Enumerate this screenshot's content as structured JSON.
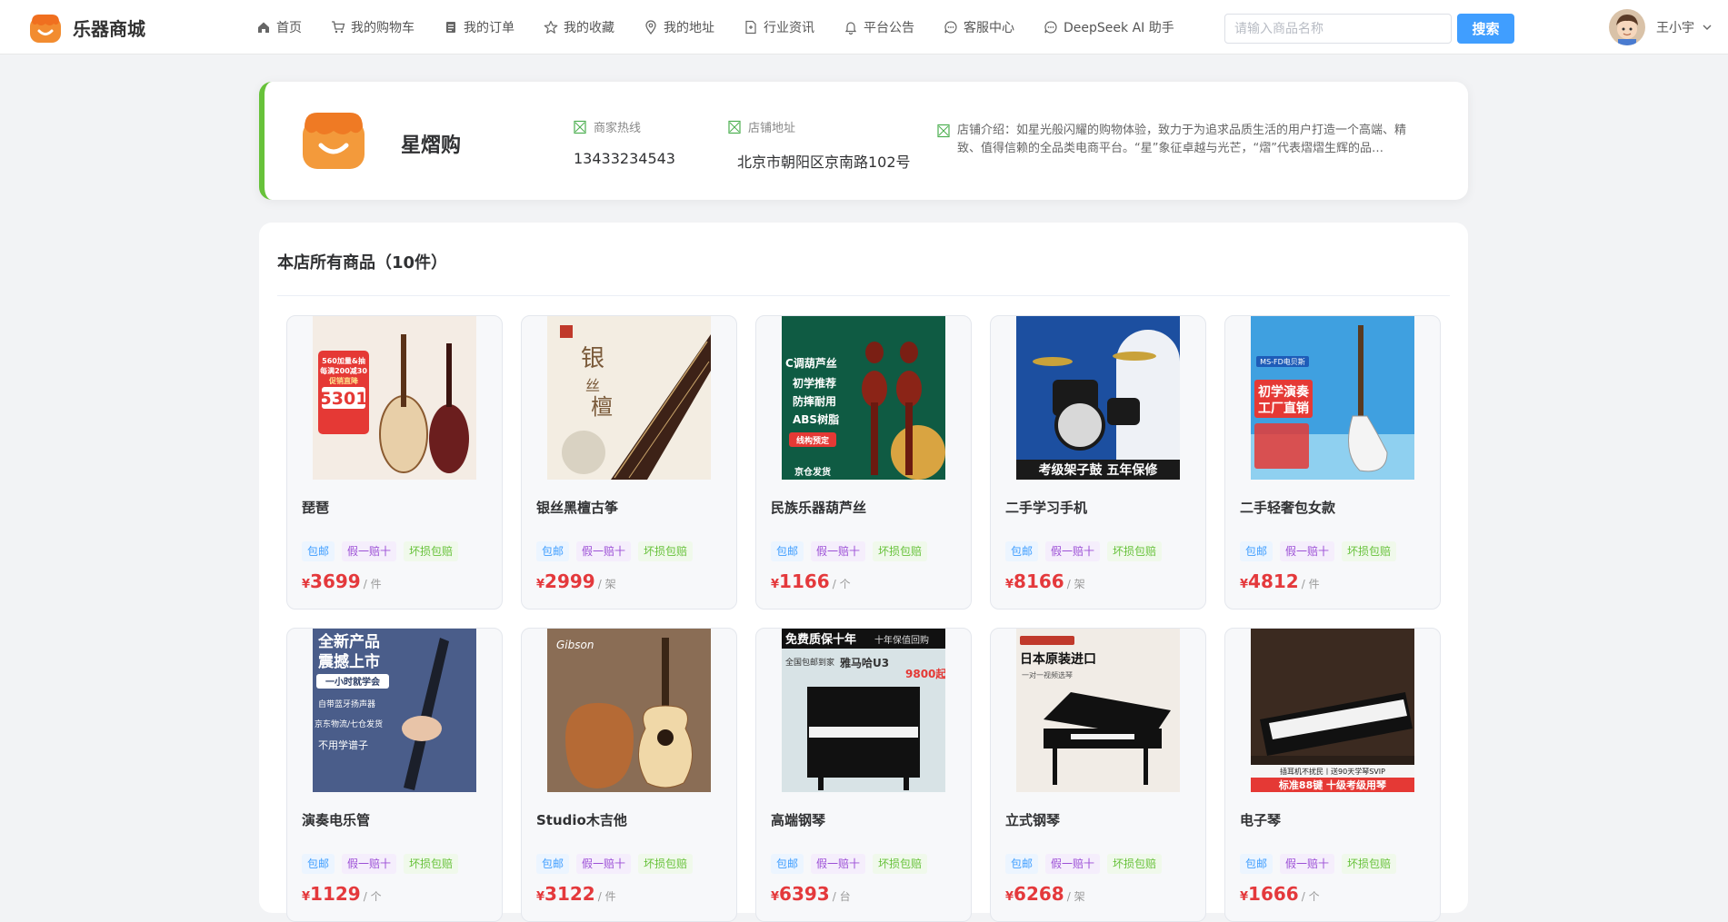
{
  "brand": {
    "name": "乐器商城"
  },
  "nav": [
    {
      "label": "首页",
      "icon": "home-icon"
    },
    {
      "label": "我的购物车",
      "icon": "cart-icon"
    },
    {
      "label": "我的订单",
      "icon": "order-icon"
    },
    {
      "label": "我的收藏",
      "icon": "star-icon"
    },
    {
      "label": "我的地址",
      "icon": "location-icon"
    },
    {
      "label": "行业资讯",
      "icon": "document-icon"
    },
    {
      "label": "平台公告",
      "icon": "bell-icon"
    },
    {
      "label": "客服中心",
      "icon": "chat-icon"
    },
    {
      "label": "DeepSeek AI 助手",
      "icon": "chat-icon"
    }
  ],
  "search": {
    "placeholder": "请输入商品名称",
    "button_label": "搜索"
  },
  "user": {
    "name": "王小宇"
  },
  "store": {
    "name": "星熠购",
    "hotline_label": "商家热线",
    "hotline": "13433234543",
    "address_label": "店铺地址",
    "address": "北京市朝阳区京南路102号",
    "intro": "店铺介绍：如星光般闪耀的购物体验，致力于为追求品质生活的用户打造一个高端、精致、值得信赖的全品类电商平台。“星”象征卓越与光芒，“熠”代表熠熠生辉的品…"
  },
  "products_panel": {
    "title": "本店所有商品（10件）"
  },
  "tags": [
    "包邮",
    "假一赔十",
    "坏损包赔"
  ],
  "currency": "¥",
  "products": [
    {
      "name": "琵琶",
      "price": "3699",
      "unit": "/ 件",
      "image_text": [
        "560加量&抽",
        "每满200减30",
        "促销直降",
        "5301"
      ]
    },
    {
      "name": "银丝黑檀古筝",
      "price": "2999",
      "unit": "/ 架",
      "image_text": [
        "银",
        "丝",
        "檀"
      ]
    },
    {
      "name": "民族乐器葫芦丝",
      "price": "1166",
      "unit": "/ 个",
      "image_text": [
        "C调葫芦丝",
        "初学推荐",
        "防摔耐用",
        "ABS树脂",
        "线构预定",
        "京仓发货"
      ]
    },
    {
      "name": "二手学习手机",
      "price": "8166",
      "unit": "/ 架",
      "image_text": [
        "考级架子鼓 五年保修"
      ]
    },
    {
      "name": "二手轻奢包女款",
      "price": "4812",
      "unit": "/ 件",
      "image_text": [
        "MS-FD电贝斯",
        "初学演奏",
        "工厂直销"
      ]
    },
    {
      "name": "演奏电乐管",
      "price": "1129",
      "unit": "/ 个",
      "image_text": [
        "全新产品",
        "震撼上市",
        "一小时就学会",
        "自带蓝牙扬声器",
        "京东物流/七仓发货",
        "不用学谱子"
      ]
    },
    {
      "name": "Studio木吉他",
      "price": "3122",
      "unit": "/ 件",
      "image_text": [
        "Gibson"
      ]
    },
    {
      "name": "高端钢琴",
      "price": "6393",
      "unit": "/ 台",
      "image_text": [
        "免费质保十年",
        "十年保值回购",
        "全国包邮到家",
        "雅马哈U3",
        "9800起"
      ]
    },
    {
      "name": "立式钢琴",
      "price": "6268",
      "unit": "/ 架",
      "image_text": [
        "日本原装进口",
        "一对一视频选琴"
      ]
    },
    {
      "name": "电子琴",
      "price": "1666",
      "unit": "/ 个",
      "image_text": [
        "插耳机不扰民丨送90天学琴SVIP",
        "标准88键 十级考级用琴"
      ]
    }
  ]
}
